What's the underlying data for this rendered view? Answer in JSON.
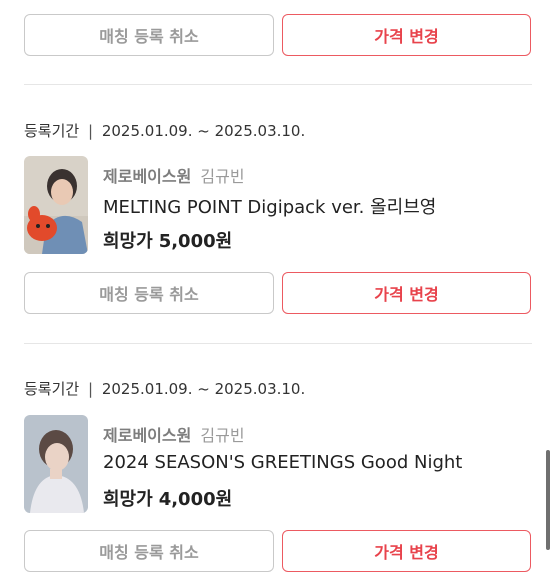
{
  "buttons": {
    "cancel_label": "매칭 등록 취소",
    "price_label": "가격 변경"
  },
  "items": [
    {
      "period_label": "등록기간",
      "period_sep": "|",
      "period_range": "2025.01.09. ~ 2025.03.10.",
      "shop": "제로베이스원",
      "member": "김규빈",
      "title": "MELTING POINT Digipack ver. 올리브영",
      "price_label": "희망가",
      "price": "5,000원"
    },
    {
      "period_label": "등록기간",
      "period_sep": "|",
      "period_range": "2025.01.09. ~ 2025.03.10.",
      "shop": "제로베이스원",
      "member": "김규빈",
      "title": "2024 SEASON'S GREETINGS Good Night",
      "price_label": "희망가",
      "price": "4,000원"
    }
  ],
  "colors": {
    "accent": "#e8434c",
    "accent_border": "#ec5a61",
    "muted_text": "#9a9a9a",
    "border": "#c9c9c9",
    "divider": "#e6e6e6"
  },
  "icons": {
    "scrollbar": "scrollbar-thumb"
  }
}
